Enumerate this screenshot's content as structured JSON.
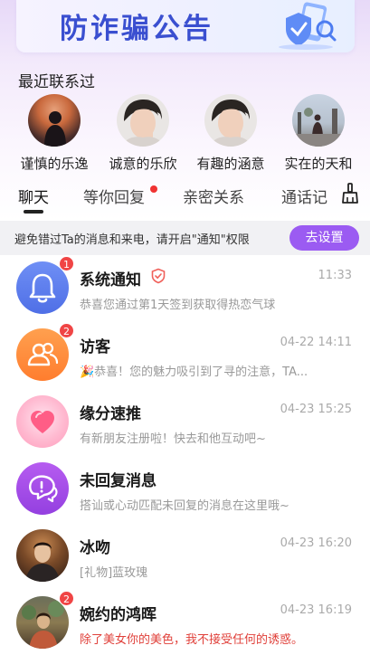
{
  "banner": {
    "title": "防诈骗公告"
  },
  "recent": {
    "title": "最近联系过",
    "contacts": [
      {
        "name": "谨慎的乐逸"
      },
      {
        "name": "诚意的乐欣"
      },
      {
        "name": "有趣的涵意"
      },
      {
        "name": "实在的天和"
      }
    ]
  },
  "tabs": [
    {
      "label": "聊天"
    },
    {
      "label": "等你回复"
    },
    {
      "label": "亲密关系"
    },
    {
      "label": "通话记"
    }
  ],
  "notice": {
    "text": "避免错过Ta的消息和来电，请开启\"通知\"权限",
    "button": "去设置"
  },
  "chats": [
    {
      "name": "系统通知",
      "time": "11:33",
      "message": "恭喜您通过第1天签到获取得热恋气球",
      "badge": "1"
    },
    {
      "name": "访客",
      "time": "04-22 14:11",
      "message": "🎉恭喜！您的魅力吸引到了寻的注意，TA...",
      "badge": "2"
    },
    {
      "name": "缘分速推",
      "time": "04-23 15:25",
      "message": "有新朋友注册啦！快去和他互动吧~",
      "badge": ""
    },
    {
      "name": "未回复消息",
      "time": "",
      "message": "搭讪或心动匹配未回复的消息在这里哦~",
      "badge": ""
    },
    {
      "name": "冰吻",
      "time": "04-23 16:20",
      "message": "[礼物]蓝玫瑰",
      "badge": ""
    },
    {
      "name": "婉约的鸿晖",
      "time": "04-23 16:19",
      "message": "除了美女你的美色，我不接受任何的诱惑。",
      "badge": "2"
    }
  ],
  "colors": {
    "accent": "#9b5bf2",
    "badge": "#f04545",
    "banner_title": "#3a4fd0",
    "system_icon": "#5b7cf0",
    "visitor_icon": "#ff8a3d",
    "match_icon": "#ff7aa8",
    "unreplied_icon": "#a24ee8"
  }
}
